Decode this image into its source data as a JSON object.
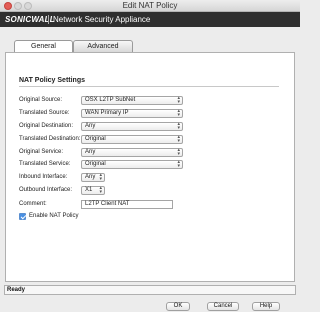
{
  "window": {
    "title": "Edit NAT Policy"
  },
  "header": {
    "logo_text": "SONICWALL",
    "title": "Network Security Appliance"
  },
  "tabs": [
    {
      "label": "General"
    },
    {
      "label": "Advanced"
    }
  ],
  "section": {
    "title": "NAT Policy Settings"
  },
  "fields": [
    {
      "label": "Original Source:",
      "value": "OSX L2TP SubNet"
    },
    {
      "label": "Translated Source:",
      "value": "WAN Primary IP"
    },
    {
      "label": "Original Destination:",
      "value": "Any"
    },
    {
      "label": "Translated Destination:",
      "value": "Original"
    },
    {
      "label": "Original Service:",
      "value": "Any"
    },
    {
      "label": "Translated Service:",
      "value": "Original"
    },
    {
      "label": "Inbound Interface:",
      "value": "Any"
    },
    {
      "label": "Outbound Interface:",
      "value": "X1"
    },
    {
      "label": "Comment:",
      "value": "L2TP Client NAT"
    }
  ],
  "enable_nat": {
    "label": "Enable NAT Policy",
    "checked": true
  },
  "status": {
    "text": "Ready"
  },
  "buttons": {
    "ok": "OK",
    "cancel": "Cancel",
    "help": "Help"
  }
}
